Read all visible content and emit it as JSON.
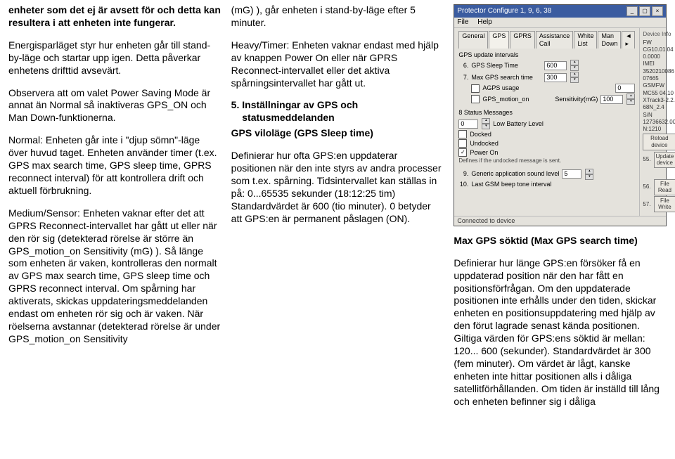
{
  "col1": {
    "p1": "enheter som det ej är avsett för och detta kan resultera i att enheten inte fungerar.",
    "p2": "Energisparläget styr hur enheten går till stand-by-läge och startar upp igen. Detta påverkar enhetens drifttid avsevärt.",
    "p3": "Observera att om valet Power Saving Mode är annat än Normal så inaktiveras GPS_ON och Man Down-funktionerna.",
    "p4": "Normal: Enheten går inte i \"djup sömn\"-läge över huvud taget. Enheten använder timer (t.ex. GPS max search time, GPS sleep time, GPRS reconnect interval) för att kontrollera drift och aktuell förbrukning.",
    "p5": "Medium/Sensor: Enheten vaknar efter det att GPRS Reconnect-intervallet har gått ut eller när den rör sig (detekterad rörelse är större än GPS_motion_on Sensitivity (mG) ). Så länge som enheten är vaken, kontrolleras den normalt av GPS max search time, GPS sleep time och GPRS reconnect interval. Om spårning har aktiverats, skickas uppdateringsmeddelanden endast om enheten rör sig och är vaken. När röelserna avstannar (detekterad rörelse är under GPS_motion_on Sensitivity"
  },
  "col2": {
    "p1": "(mG) ), går enheten i stand-by-läge efter 5 minuter.",
    "p2": "Heavy/Timer: Enheten vaknar endast med hjälp av knappen Power On eller när GPRS Reconnect-intervallet eller det aktiva spårningsintervallet har gått ut.",
    "h5_num": "5.",
    "h5a": "Inställningar av GPS och",
    "h5b": "statusmeddelanden",
    "sub": "GPS viloläge (GPS Sleep time)",
    "p3": "Definierar hur ofta GPS:en uppdaterar positionen när den inte styrs av andra processer som t.ex. spårning. Tidsintervallet kan ställas in på: 0...65535 sekunder (18:12:25 tim) Standardvärdet är 600 (tio minuter). 0 betyder att GPS:en är permanent påslagen (ON)."
  },
  "dlg": {
    "title": "Protector Configure 1, 9, 6, 38",
    "close": "×",
    "menu": {
      "file": "File",
      "help": "Help"
    },
    "tabs": [
      "General",
      "GPS",
      "GPRS",
      "Assistance Call",
      "White List",
      "Man Down"
    ],
    "tabs_more": "◄ ▸",
    "sec_updates": "GPS update intervals",
    "r6_num": "6.",
    "r6_lbl": "GPS Sleep Time",
    "r6_val": "600",
    "r7_num": "7.",
    "r7_lbl": "Max GPS search time",
    "r7_val": "300",
    "agps_lbl": "AGPS usage",
    "agps_val": "0",
    "motion_lbl": "GPS_motion_on",
    "sens_lbl": "Sensitivity(mG)",
    "sens_val": "100",
    "sec_status": "8 Status Messages",
    "lowbat_val": "0",
    "lowbat_lbl": "Low Battery Level",
    "docked": "Docked",
    "undocked": "Undocked",
    "poweron": "Power On",
    "defines": "Defines if the undocked message is sent.",
    "r9_num": "9.",
    "r9_lbl": "Generic application sound level",
    "r9_val": "5",
    "r10_num": "10.",
    "r10_lbl": "Last GSM beep tone interval",
    "side": {
      "devinfo": "Device Info",
      "fw": "FW",
      "fw_v": "CG10.01.040.0000",
      "imei": "IMEI",
      "imei_v": "352021008607665",
      "gsm": "GSMFW",
      "gsm_v": "MC55 04.10",
      "gsm_v2": "XTrack3-2.2.68N_2.4",
      "sn": "S/N",
      "sn_v": "12736632.00N:1210",
      "reload": "Reload device",
      "update_num": "55.",
      "update": "Update device",
      "fr_num": "56.",
      "fr": "File Read",
      "fw_num": "57.",
      "fwr": "File Write"
    },
    "status": "Connected to device"
  },
  "col3": {
    "h": "Max GPS söktid (Max GPS search time)",
    "p": "Definierar hur länge GPS:en försöker få en uppdaterad position när den har fått en positionsförfrågan. Om den uppdaterade positionen inte erhålls under den tiden, skickar enheten en positionsuppdatering med hjälp av den förut lagrade senast kända positionen. Giltiga värden för GPS:ens söktid är mellan:  120... 600 (sekunder). Standardvärdet är 300 (fem minuter). Om värdet är lågt, kanske enheten inte hittar positionen alls i dåliga satellitförhållanden. Om tiden är inställd till lång och enheten befinner sig i dåliga"
  }
}
